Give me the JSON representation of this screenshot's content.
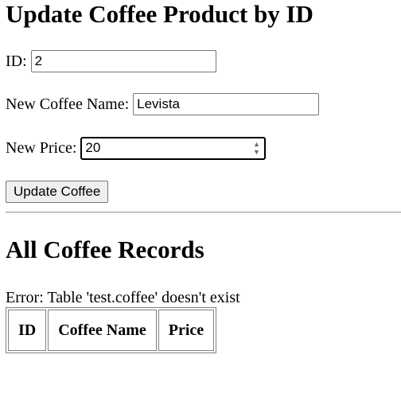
{
  "page": {
    "title": "Update Coffee Product by ID"
  },
  "form": {
    "id_label": "ID:",
    "id_value": "2",
    "name_label": "New Coffee Name:",
    "name_value": "Levista",
    "price_label": "New Price:",
    "price_value": "20",
    "submit_label": "Update Coffee"
  },
  "records": {
    "heading": "All Coffee Records",
    "error": "Error: Table 'test.coffee' doesn't exist",
    "columns": [
      "ID",
      "Coffee Name",
      "Price"
    ]
  },
  "icons": {
    "spinner_up": "triangle-up-icon",
    "spinner_down": "triangle-down-icon"
  }
}
